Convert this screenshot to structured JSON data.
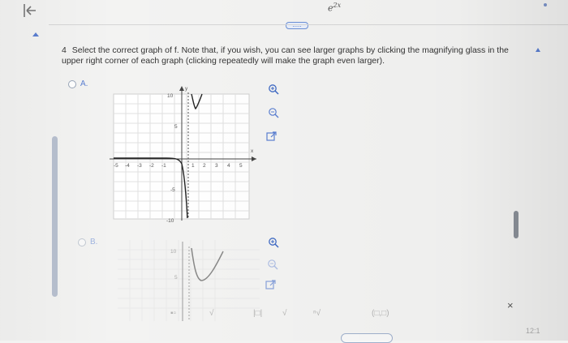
{
  "header": {
    "formula_base": "e",
    "formula_exponent": "2x",
    "more_label": "....."
  },
  "question": {
    "number": "4",
    "text": "Select the correct graph of f. Note that, if you wish, you can see larger graphs by clicking the magnifying glass in the upper right corner of each graph (clicking repeatedly will make the graph even larger)."
  },
  "choices": [
    {
      "label": "A.",
      "selected": false
    },
    {
      "label": "B.",
      "selected": false
    }
  ],
  "graph_a": {
    "y_label": "y",
    "x_label": "x",
    "y_ticks": [
      "10",
      "5",
      "-5",
      "-10"
    ],
    "x_ticks": [
      "-5",
      "-4",
      "-3",
      "-2",
      "-1",
      "1",
      "2",
      "3",
      "4",
      "5"
    ]
  },
  "graph_b": {
    "y_ticks": [
      "10",
      "5"
    ]
  },
  "tools": {
    "zoom_in": "zoom-in",
    "zoom_out": "zoom-out",
    "expand": "external-expand"
  },
  "bottom": {
    "close_label": "×",
    "corner_text": "12:1"
  },
  "colors": {
    "accent": "#5b7fd1",
    "graph_line": "#333333",
    "grid": "#d9d9d9"
  }
}
